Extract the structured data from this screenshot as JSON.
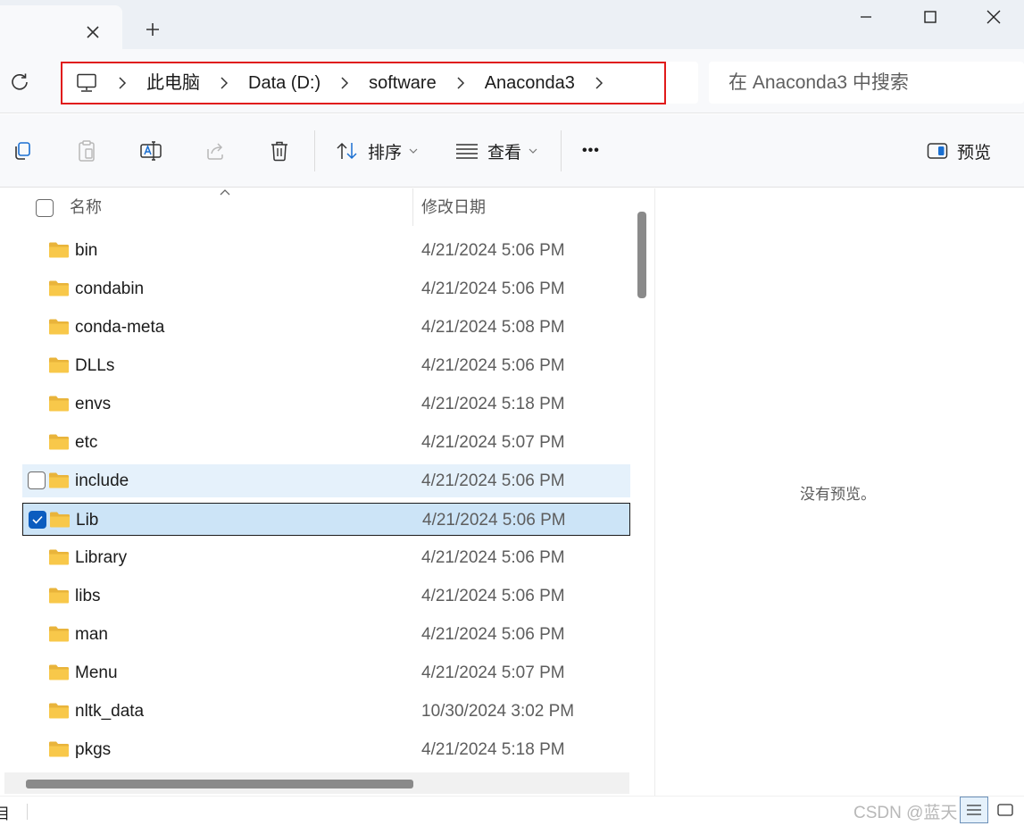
{
  "window": {
    "tab_close_icon": "close-icon",
    "new_tab_icon": "plus-icon",
    "minimize_icon": "minimize-icon",
    "maximize_icon": "maximize-icon",
    "close_icon": "close-icon"
  },
  "address": {
    "root_icon": "computer-icon",
    "crumbs": [
      "此电脑",
      "Data (D:)",
      "software",
      "Anaconda3"
    ],
    "highlight_color": "#e01a1a"
  },
  "search": {
    "placeholder": "在 Anaconda3 中搜索"
  },
  "toolbar": {
    "sort_label": "排序",
    "view_label": "查看",
    "more_label": "•••",
    "preview_label": "预览"
  },
  "columns": {
    "name": "名称",
    "date": "修改日期"
  },
  "files": [
    {
      "name": "bin",
      "date": "4/21/2024 5:06 PM"
    },
    {
      "name": "condabin",
      "date": "4/21/2024 5:06 PM"
    },
    {
      "name": "conda-meta",
      "date": "4/21/2024 5:08 PM"
    },
    {
      "name": "DLLs",
      "date": "4/21/2024 5:06 PM"
    },
    {
      "name": "envs",
      "date": "4/21/2024 5:18 PM"
    },
    {
      "name": "etc",
      "date": "4/21/2024 5:07 PM"
    },
    {
      "name": "include",
      "date": "4/21/2024 5:06 PM",
      "state": "hover"
    },
    {
      "name": "Lib",
      "date": "4/21/2024 5:06 PM",
      "state": "selected"
    },
    {
      "name": "Library",
      "date": "4/21/2024 5:06 PM"
    },
    {
      "name": "libs",
      "date": "4/21/2024 5:06 PM"
    },
    {
      "name": "man",
      "date": "4/21/2024 5:06 PM"
    },
    {
      "name": "Menu",
      "date": "4/21/2024 5:07 PM"
    },
    {
      "name": "nltk_data",
      "date": "10/30/2024 3:02 PM"
    },
    {
      "name": "pkgs",
      "date": "4/21/2024 5:18 PM"
    }
  ],
  "preview_pane": {
    "empty_text": "没有预览。"
  },
  "status": {
    "count_text": "目",
    "watermark": "CSDN @蓝天白"
  },
  "colors": {
    "selected_bg": "#cce4f7",
    "hover_bg": "#e5f1fb",
    "checkbox_on": "#0b5cbf",
    "folder": "#f8c84a"
  }
}
